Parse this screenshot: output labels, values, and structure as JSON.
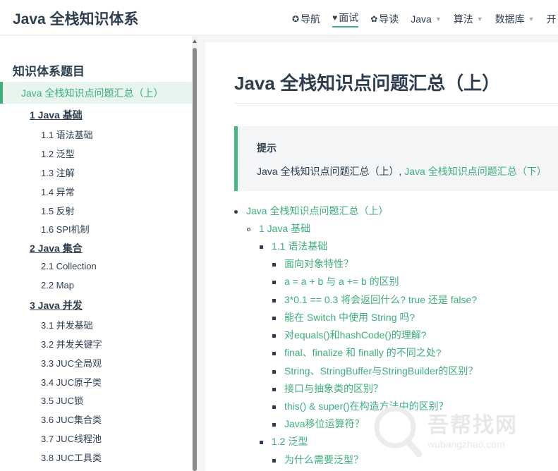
{
  "navbar": {
    "site_title": "Java 全栈知识体系",
    "links": [
      {
        "icon": "compass-icon",
        "glyph": "✪",
        "label": "导航",
        "active": false,
        "dropdown": false
      },
      {
        "icon": "heart-icon",
        "glyph": "♥",
        "label": "面试",
        "active": true,
        "dropdown": false
      },
      {
        "icon": "flower-icon",
        "glyph": "✿",
        "label": "导读",
        "active": false,
        "dropdown": false
      },
      {
        "label": "Java",
        "dropdown": true
      },
      {
        "label": "算法",
        "dropdown": true
      },
      {
        "label": "数据库",
        "dropdown": true
      },
      {
        "label": "开"
      }
    ]
  },
  "sidebar": {
    "heading": "知识体系题目",
    "active_item": "Java 全栈知识点问题汇总（上）",
    "sections": [
      {
        "title": "1 Java 基础",
        "items": [
          "1.1 语法基础",
          "1.2 泛型",
          "1.3 注解",
          "1.4 异常",
          "1.5 反射",
          "1.6 SPI机制"
        ]
      },
      {
        "title": "2 Java 集合",
        "items": [
          "2.1 Collection",
          "2.2 Map"
        ]
      },
      {
        "title": "3 Java 并发",
        "items": [
          "3.1 并发基础",
          "3.2 并发关键字",
          "3.3 JUC全局观",
          "3.4 JUC原子类",
          "3.5 JUC锁",
          "3.6 JUC集合类",
          "3.7 JUC线程池",
          "3.8 JUC工具类"
        ]
      }
    ]
  },
  "content": {
    "title": "Java 全栈知识点问题汇总（上）",
    "tip": {
      "title": "提示",
      "text": "Java 全栈知识点问题汇总（上）, ",
      "link": "Java 全栈知识点问题汇总（下）"
    },
    "toc": [
      {
        "level": 1,
        "text": "Java 全栈知识点问题汇总（上）"
      },
      {
        "level": 2,
        "text": "1 Java 基础"
      },
      {
        "level": 3,
        "text": "1.1 语法基础"
      },
      {
        "level": 4,
        "text": "面向对象特性？"
      },
      {
        "level": 4,
        "text": "a = a + b 与 a += b 的区别"
      },
      {
        "level": 4,
        "text": "3*0.1 == 0.3 将会返回什么? true 还是 false?"
      },
      {
        "level": 4,
        "text": "能在 Switch 中使用 String 吗?"
      },
      {
        "level": 4,
        "text": "对equals()和hashCode()的理解?"
      },
      {
        "level": 4,
        "text": "final、finalize 和 finally 的不同之处?"
      },
      {
        "level": 4,
        "text": "String、StringBuffer与StringBuilder的区别？"
      },
      {
        "level": 4,
        "text": "接口与抽象类的区别？"
      },
      {
        "level": 4,
        "text": "this() & super()在构造方法中的区别？"
      },
      {
        "level": 4,
        "text": "Java移位运算符？"
      },
      {
        "level": 3,
        "text": "1.2 泛型"
      },
      {
        "level": 4,
        "text": "为什么需要泛型？"
      }
    ]
  },
  "watermark": {
    "cn": "吾帮找网",
    "en": "wubangzhao.com"
  },
  "colors": {
    "accent": "#3eaf7c",
    "text": "#2c3e50",
    "tip_bg": "#f3f5f7"
  }
}
